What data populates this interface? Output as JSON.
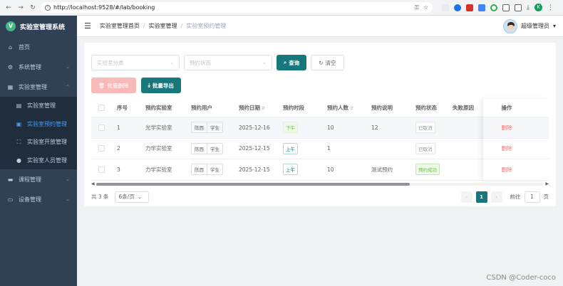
{
  "browser": {
    "url": "http://localhost:9528/#/lab/booking",
    "profile_initial": "K"
  },
  "sidebar": {
    "logo_text": "实验室管理系统",
    "items": [
      {
        "label": "首页",
        "icon": "home-icon"
      },
      {
        "label": "系统管理",
        "icon": "gear-icon"
      },
      {
        "label": "实验室管理",
        "icon": "building-icon"
      }
    ],
    "sub_items": [
      {
        "label": "实验室管理",
        "icon": "grid-icon"
      },
      {
        "label": "实验室预约管理",
        "icon": "calendar-icon"
      },
      {
        "label": "实验室开放管理",
        "icon": "expand-icon"
      },
      {
        "label": "实验室人员管理",
        "icon": "user-icon"
      }
    ],
    "bottom_items": [
      {
        "label": "课程管理",
        "icon": "book-icon"
      },
      {
        "label": "设备管理",
        "icon": "monitor-icon"
      }
    ]
  },
  "header": {
    "breadcrumb": [
      "实验室管理首页",
      "实验室管理",
      "实验室预约管理"
    ],
    "user_name": "超级管理员"
  },
  "filters": {
    "category_placeholder": "实验室分类",
    "status_placeholder": "预约状态",
    "search_label": "查询",
    "clear_label": "清空"
  },
  "actions": {
    "batch_delete": "批量删除",
    "batch_export": "批量导出"
  },
  "table": {
    "headers": {
      "index": "序号",
      "lab": "预约实验室",
      "user": "预约用户",
      "date": "预约日期",
      "slot": "预约时段",
      "count": "预约人数",
      "desc": "预约说明",
      "status": "预约状态",
      "fail": "失败原因",
      "op": "操作"
    },
    "rows": [
      {
        "index": "1",
        "lab": "光学实验室",
        "user_name": "陈西",
        "user_role": "学生",
        "date": "2025-12-16",
        "slot": "下午",
        "count": "10",
        "desc": "12",
        "status": "已取消",
        "op": "删除"
      },
      {
        "index": "2",
        "lab": "力学实验室",
        "user_name": "陈西",
        "user_role": "学生",
        "date": "2025-12-15",
        "slot": "上午",
        "count": "1",
        "desc": "",
        "status": "已取消",
        "op": "删除"
      },
      {
        "index": "3",
        "lab": "力学实验室",
        "user_name": "陈西",
        "user_role": "学生",
        "date": "2025-12-15",
        "slot": "上午",
        "count": "10",
        "desc": "测试预约",
        "status": "预约成功",
        "op": "删除"
      }
    ]
  },
  "pagination": {
    "total": "共 3 条",
    "page_size": "6条/页",
    "current_page": "1",
    "goto_label": "前往",
    "goto_value": "1",
    "page_suffix": "页"
  },
  "watermark": "CSDN @Coder-coco",
  "colors": {
    "sidebar_bg": "#304156",
    "accent": "#18777a",
    "danger": "#f56c6c",
    "active_menu": "#409eff"
  }
}
